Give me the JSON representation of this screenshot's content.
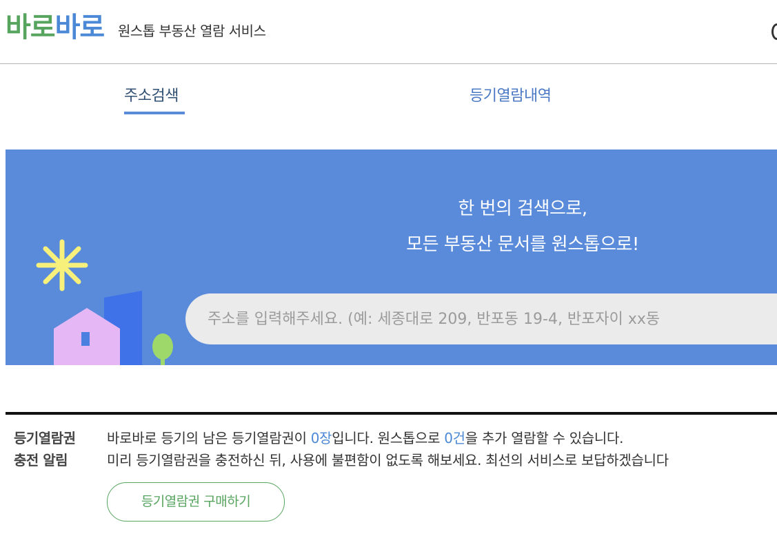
{
  "header": {
    "logo_part1": "바로",
    "logo_part2": "바로",
    "tagline": "원스톱 부동산 열람 서비스"
  },
  "tabs": [
    {
      "label": "주소검색",
      "active": true
    },
    {
      "label": "등기열람내역",
      "active": false
    }
  ],
  "banner": {
    "headline_line1": "한 번의 검색으로,",
    "headline_line2": "모든 부동산 문서를 원스톱으로!",
    "search_placeholder": "주소를 입력해주세요. (예: 세종대로 209, 반포동 19-4, 반포자이 xx동"
  },
  "notice": {
    "title_line1": "등기열람권",
    "title_line2": "충전 알림",
    "line1_prefix": "바로바로 등기의 남은 등기열람권이 ",
    "line1_count1": "0장",
    "line1_mid": "입니다. 원스톱으로 ",
    "line1_count2": "0건",
    "line1_suffix": "을 추가 열람할 수 있습니다.",
    "line2": "미리 등기열람권을 충전하신 뒤, 사용에 불편함이 없도록 해보세요. 최선의 서비스로 보답하겠습니다",
    "buy_button": "등기열람권 구매하기"
  },
  "colors": {
    "brand_green": "#57a45f",
    "brand_blue": "#4b89d6",
    "banner_bg": "#5a8bdb",
    "search_bg": "#ebebeb"
  },
  "icons": {
    "sun": "sun-icon",
    "house": "house-icon",
    "building": "building-icon",
    "tree": "tree-icon"
  }
}
